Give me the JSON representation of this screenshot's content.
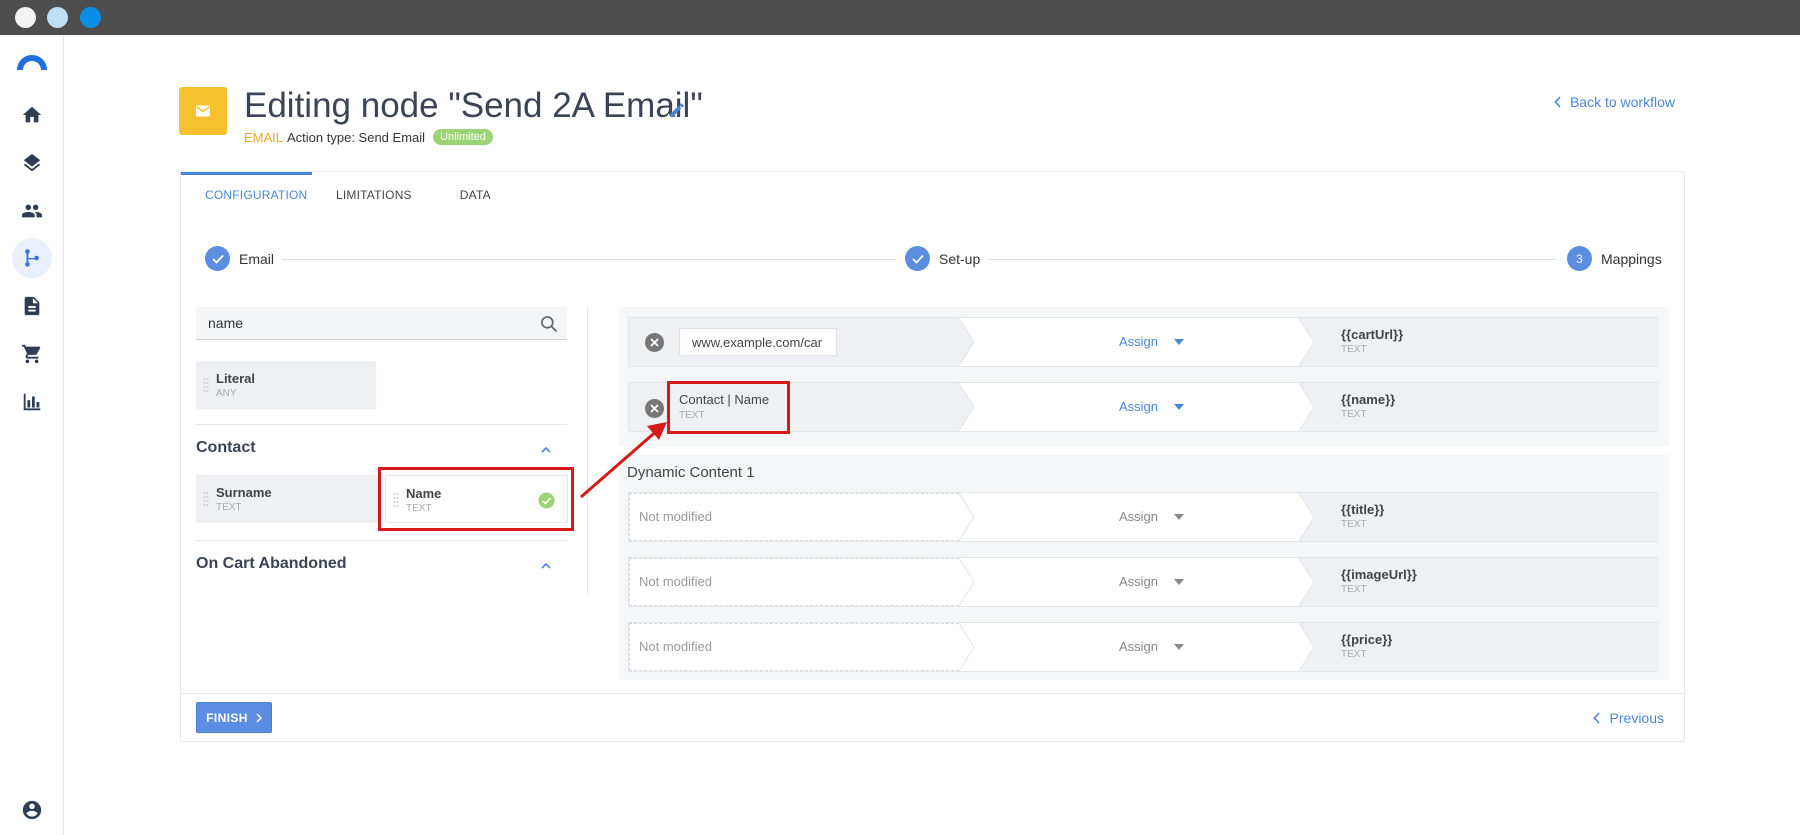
{
  "header": {
    "title": "Editing node \"Send 2A Email\"",
    "type_label": "EMAIL",
    "action_label": "Action type: Send Email",
    "badge": "Unlimited",
    "back_link": "Back to workflow"
  },
  "tabs": [
    {
      "label": "CONFIGURATION",
      "active": true
    },
    {
      "label": "LIMITATIONS"
    },
    {
      "label": "DATA"
    }
  ],
  "steps": [
    {
      "label": "Email",
      "state": "done"
    },
    {
      "label": "Set-up",
      "state": "done"
    },
    {
      "label": "Mappings",
      "number": "3",
      "state": "current"
    }
  ],
  "left": {
    "search_value": "name",
    "literal": {
      "name": "Literal",
      "type": "ANY"
    },
    "sections": [
      {
        "title": "Contact",
        "fields": [
          {
            "name": "Surname",
            "type": "TEXT"
          },
          {
            "name": "Name",
            "type": "TEXT",
            "selected": true
          }
        ]
      },
      {
        "title": "On Cart Abandoned"
      }
    ]
  },
  "mappings": {
    "rows": [
      {
        "source_value": "www.example.com/car",
        "assign": "Assign",
        "target": "{{cartUrl}}",
        "target_type": "TEXT"
      },
      {
        "source_text": "Contact | Name",
        "source_type": "TEXT",
        "assign": "Assign",
        "target": "{{name}}",
        "target_type": "TEXT"
      }
    ],
    "dynamic_title": "Dynamic Content 1",
    "dynamic_rows": [
      {
        "placeholder": "Not modified",
        "assign": "Assign",
        "target": "{{title}}",
        "target_type": "TEXT"
      },
      {
        "placeholder": "Not modified",
        "assign": "Assign",
        "target": "{{imageUrl}}",
        "target_type": "TEXT"
      },
      {
        "placeholder": "Not modified",
        "assign": "Assign",
        "target": "{{price}}",
        "target_type": "TEXT"
      }
    ]
  },
  "footer": {
    "finish": "FINISH",
    "previous": "Previous"
  },
  "colors": {
    "accent": "#4a86d8",
    "node_icon": "#f5c12e",
    "badge": "#9bd474",
    "highlight": "#d61a1a"
  },
  "icons": [
    "home-icon",
    "layers-icon",
    "people-icon",
    "workflow-icon",
    "document-icon",
    "cart-icon",
    "chart-icon",
    "account-icon",
    "mail-icon",
    "pencil-icon",
    "search-icon",
    "check-icon",
    "remove-icon",
    "chevron-up-icon",
    "chevron-left-icon",
    "chevron-right-icon"
  ]
}
